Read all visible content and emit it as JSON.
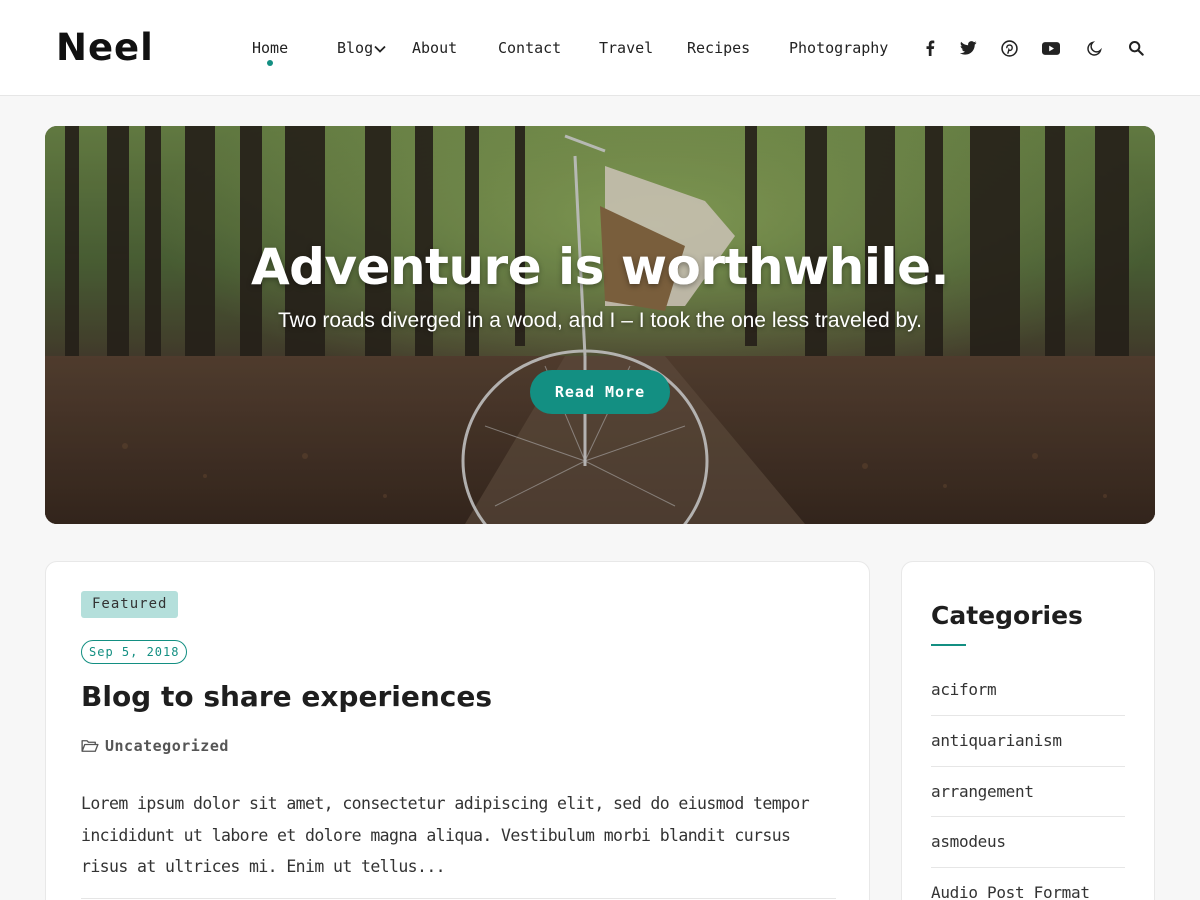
{
  "site": {
    "logo": "Neel"
  },
  "nav": {
    "items": [
      {
        "label": "Home",
        "active": true
      },
      {
        "label": "Blog",
        "has_dropdown": true
      },
      {
        "label": "About"
      },
      {
        "label": "Contact"
      },
      {
        "label": "Travel"
      },
      {
        "label": "Recipes"
      },
      {
        "label": "Photography"
      }
    ],
    "icons": [
      "facebook-icon",
      "twitter-icon",
      "pinterest-icon",
      "youtube-icon",
      "dark-mode-icon",
      "search-icon"
    ]
  },
  "hero": {
    "title": "Adventure is worthwhile.",
    "subtitle": "Two roads diverged in a wood, and I – I took the one less traveled by.",
    "button_label": "Read More"
  },
  "post": {
    "badge": "Featured",
    "date": "Sep 5, 2018",
    "title": "Blog to share experiences",
    "category": "Uncategorized",
    "excerpt": "Lorem ipsum dolor sit amet, consectetur adipiscing elit, sed do eiusmod tempor incididunt ut labore et dolore magna aliqua. Vestibulum morbi blandit cursus risus at ultrices mi. Enim ut tellus..."
  },
  "sidebar": {
    "title": "Categories",
    "categories": [
      "aciform",
      "antiquarianism",
      "arrangement",
      "asmodeus",
      "Audio Post Format"
    ]
  },
  "colors": {
    "accent": "#138f82",
    "featured_bg": "#b4dfdb",
    "page_bg": "#f7f7f7"
  }
}
